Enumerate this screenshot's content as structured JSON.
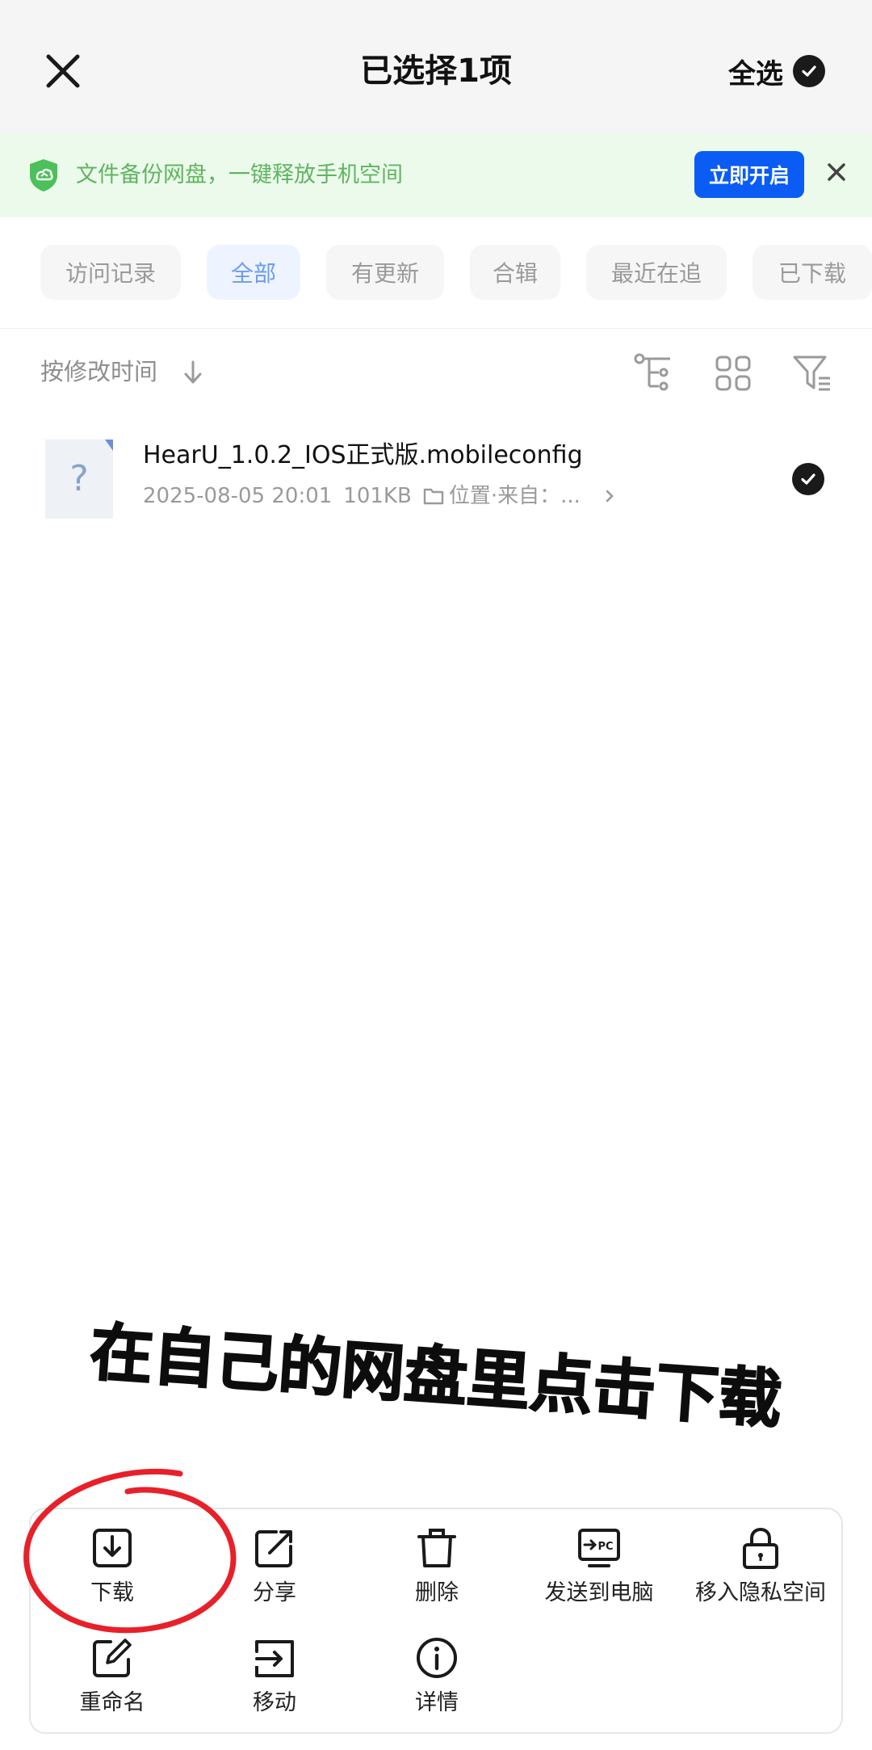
{
  "header": {
    "title": "已选择1项",
    "select_all_label": "全选"
  },
  "banner": {
    "text": "文件备份网盘，一键释放手机空间",
    "button_label": "立即开启"
  },
  "tabs": [
    {
      "label": "访问记录",
      "active": false
    },
    {
      "label": "全部",
      "active": true
    },
    {
      "label": "有更新",
      "active": false
    },
    {
      "label": "合辑",
      "active": false
    },
    {
      "label": "最近在追",
      "active": false
    },
    {
      "label": "已下载",
      "active": false
    }
  ],
  "sort": {
    "label": "按修改时间"
  },
  "file": {
    "name": "HearU_1.0.2_IOS正式版.mobileconfig",
    "date": "2025-08-05 20:01",
    "size": "101KB",
    "location": "位置·来自：...",
    "selected": true
  },
  "caption": {
    "text": "在自己的网盘里点击下载"
  },
  "actions": [
    {
      "label": "下载",
      "icon": "download-icon"
    },
    {
      "label": "分享",
      "icon": "share-icon"
    },
    {
      "label": "删除",
      "icon": "trash-icon"
    },
    {
      "label": "发送到电脑",
      "icon": "send-to-pc-icon"
    },
    {
      "label": "移入隐私空间",
      "icon": "lock-icon"
    },
    {
      "label": "重命名",
      "icon": "rename-icon"
    },
    {
      "label": "移动",
      "icon": "move-icon"
    },
    {
      "label": "详情",
      "icon": "info-icon"
    }
  ],
  "colors": {
    "primary": "#0a5cf5",
    "banner_bg": "#ecfaec",
    "banner_text": "#5fb55f",
    "tab_active_text": "#6b9bf4",
    "annotation_red": "#e8202a"
  }
}
